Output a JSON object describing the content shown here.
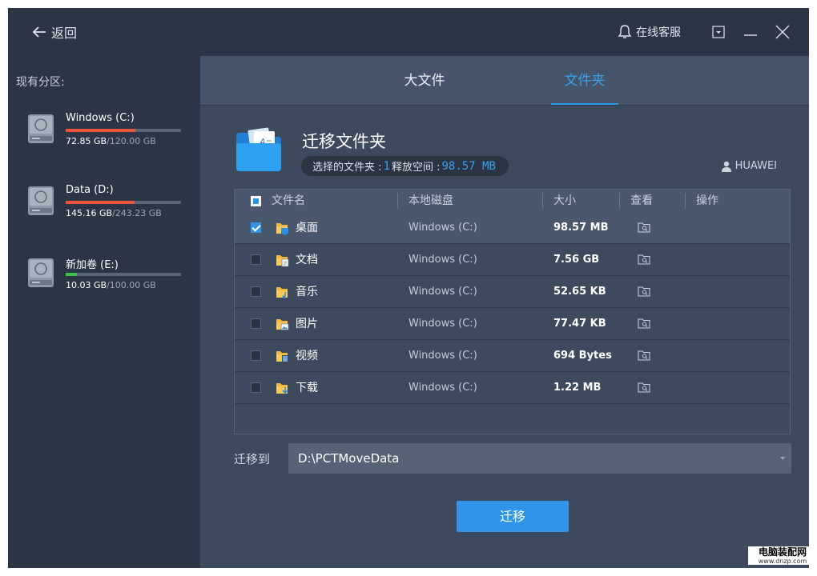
{
  "titlebar": {
    "back_label": "返回",
    "support_label": "在线客服"
  },
  "sidebar": {
    "title": "现有分区:",
    "partitions": [
      {
        "name": "Windows (C:)",
        "used": "72.85 GB",
        "total": "/120.00 GB",
        "usage_fraction": 0.607,
        "bar_color": "#e8553a"
      },
      {
        "name": "Data (D:)",
        "used": "145.16 GB",
        "total": "/243.23 GB",
        "usage_fraction": 0.597,
        "bar_color": "#e8553a"
      },
      {
        "name": "新加卷 (E:)",
        "used": "10.03 GB",
        "total": "/100.00 GB",
        "usage_fraction": 0.1,
        "bar_color": "#3cc24a"
      }
    ]
  },
  "tabs": [
    {
      "label": "大文件",
      "active": false
    },
    {
      "label": "文件夹",
      "active": true
    }
  ],
  "section": {
    "title": "迁移文件夹",
    "selected_label": "选择的文件夹 : ",
    "selected_count": "1",
    "free_label": " 释放空间 : ",
    "free_value": "98.57 MB",
    "user": "HUAWEI"
  },
  "table": {
    "columns": [
      "文件名",
      "本地磁盘",
      "大小",
      "查看",
      "操作"
    ],
    "rows": [
      {
        "name": "桌面",
        "disk": "Windows (C:)",
        "size": "98.57 MB",
        "checked": true,
        "icon": "desktop-folder-icon"
      },
      {
        "name": "文档",
        "disk": "Windows (C:)",
        "size": "7.56 GB",
        "checked": false,
        "icon": "documents-folder-icon"
      },
      {
        "name": "音乐",
        "disk": "Windows (C:)",
        "size": "52.65 KB",
        "checked": false,
        "icon": "music-folder-icon"
      },
      {
        "name": "图片",
        "disk": "Windows (C:)",
        "size": "77.47 KB",
        "checked": false,
        "icon": "pictures-folder-icon"
      },
      {
        "name": "视频",
        "disk": "Windows (C:)",
        "size": "694 Bytes",
        "checked": false,
        "icon": "videos-folder-icon"
      },
      {
        "name": "下载",
        "disk": "Windows (C:)",
        "size": "1.22 MB",
        "checked": false,
        "icon": "downloads-folder-icon"
      }
    ]
  },
  "destination": {
    "label": "迁移到",
    "path": "D:\\PCTMoveData"
  },
  "action": {
    "migrate_label": "迁移"
  },
  "watermark": {
    "line1": "电脑装配网",
    "line2": "www.dnzp.com"
  },
  "colors": {
    "accent": "#2f95e8",
    "window_bg": "#3d4a5d",
    "sidebar_bg": "#2b3545"
  }
}
